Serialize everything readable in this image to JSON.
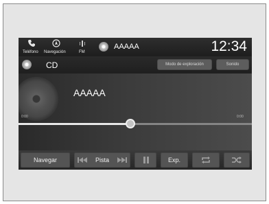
{
  "top_bar": {
    "phone_label": "Teléfono",
    "nav_label": "Navegación",
    "fm_label": "FM",
    "track_title": "AAAAA",
    "clock": "12:34"
  },
  "source_row": {
    "source": "CD",
    "scan_mode_label": "Modo de exploración",
    "sound_label": "Sonido"
  },
  "player": {
    "track_title": "AAAAA",
    "progress_fraction": 0.48
  },
  "bottom_bar": {
    "browse_label": "Navegar",
    "track_label": "Pista",
    "explore_label": "Exp.",
    "icons": [
      "previous-track-icon",
      "next-track-icon",
      "pause-icon",
      "repeat-icon",
      "shuffle-icon"
    ]
  }
}
